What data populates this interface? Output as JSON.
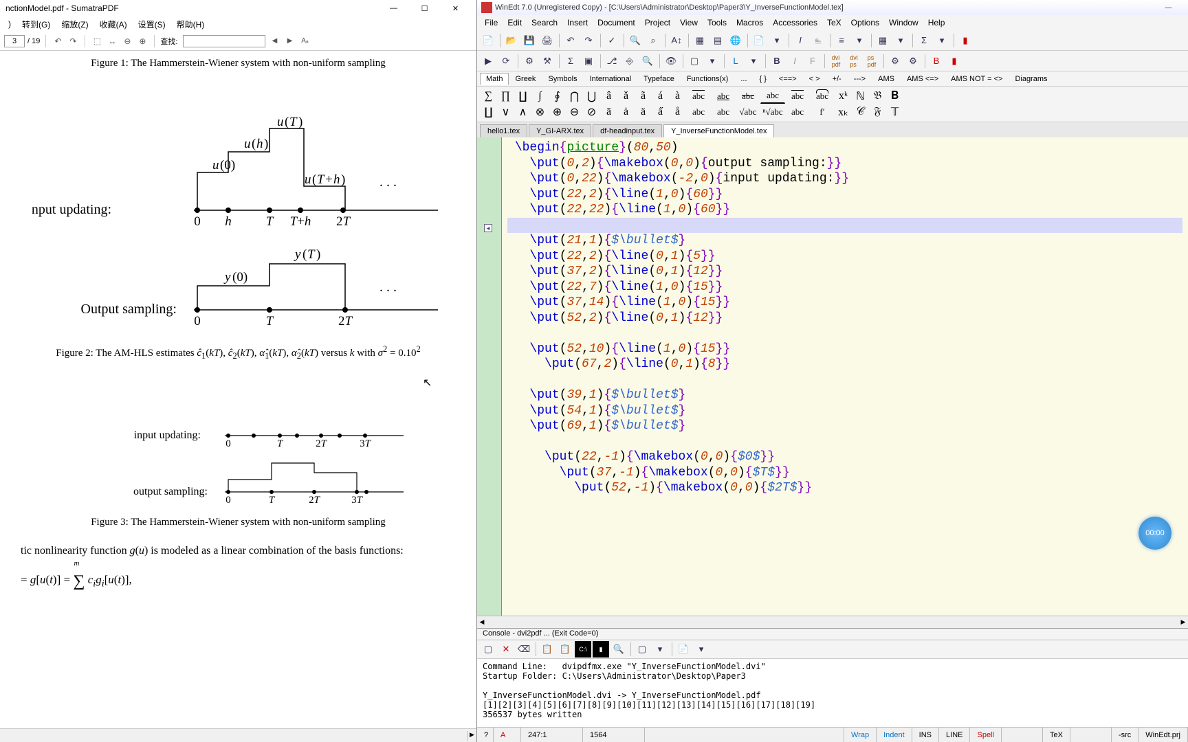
{
  "sumatra": {
    "title": "nctionModel.pdf - SumatraPDF",
    "menu": [
      ")",
      "转到(G)",
      "缩放(Z)",
      "收藏(A)",
      "设置(S)",
      "帮助(H)"
    ],
    "page_current": "3",
    "page_total": "/ 19",
    "search_label": "查找:",
    "search_value": "",
    "captions": {
      "fig1": "Figure 1: The Hammerstein-Wiener system with non-uniform sampling",
      "fig2_pre": "Figure 2: The AM-HLS estimates ",
      "fig2_mid": " versus ",
      "fig2_post": " with ",
      "fig3": "Figure 3: The Hammerstein-Wiener system with non-uniform sampling",
      "body_pre": "tic nonlinearity function ",
      "body_post": " is modeled as a linear combination of the basis functions:"
    },
    "labels": {
      "input_updating": "Input updating:",
      "output_sampling": "Output sampling:",
      "input_updating_s": "input updating:",
      "output_sampling_s": "output sampling:"
    }
  },
  "winedt": {
    "title": "WinEdt 7.0 (Unregistered   Copy)  -  [C:\\Users\\Administrator\\Desktop\\Paper3\\Y_InverseFunctionModel.tex]",
    "menu": [
      "File",
      "Edit",
      "Search",
      "Insert",
      "Document",
      "Project",
      "View",
      "Tools",
      "Macros",
      "Accessories",
      "TeX",
      "Options",
      "Window",
      "Help"
    ],
    "math_tabs": [
      "Math",
      "Greek",
      "Symbols",
      "International",
      "Typeface",
      "Functions(x)",
      "...",
      "{ }",
      "<==>",
      "< >",
      "+/-",
      "--->",
      "AMS",
      "AMS   <=>",
      "AMS NOT = <>",
      "Diagrams"
    ],
    "math_row1": [
      "∑",
      "∏",
      "∐",
      "∫",
      "∮",
      "⋂",
      "⋃",
      "â",
      "ǎ",
      "ã",
      "á",
      "à",
      "abc",
      "abc",
      "abc",
      "abc",
      "abc",
      "abc",
      "xᵏ",
      "ℕ",
      "𝔅",
      "𝐁"
    ],
    "math_row2": [
      "∐",
      "∨",
      "∧",
      "⊗",
      "⊕",
      "⊖",
      "⊘",
      "ā",
      "ȧ",
      "ä",
      "a̋",
      "å",
      "abc",
      "abc",
      "√abc",
      "ⁿ√abc",
      "abc",
      "f′",
      "xₖ",
      "𝒞",
      "𝔉",
      "𝕋"
    ],
    "file_tabs": [
      "hello1.tex",
      "Y_GI-ARX.tex",
      "df-headinput.tex",
      "Y_InverseFunctionModel.tex"
    ],
    "active_tab": 3,
    "code_lines": [
      {
        "indent": 0,
        "raw": "\\begin{picture}(80,50)",
        "type": "begin"
      },
      {
        "indent": 1,
        "raw": "\\put(0,2){\\makebox(0,0){output sampling:}}"
      },
      {
        "indent": 1,
        "raw": "\\put(0,22){\\makebox(-2,0){input updating:}}"
      },
      {
        "indent": 1,
        "raw": "\\put(22,2){\\line(1,0){60}}"
      },
      {
        "indent": 1,
        "raw": "\\put(22,22){\\line(1,0){60}}"
      },
      {
        "indent": 0,
        "raw": "",
        "hl": true
      },
      {
        "indent": 1,
        "raw": "\\put(21,1){$\\bullet$}"
      },
      {
        "indent": 1,
        "raw": "\\put(22,2){\\line(0,1){5}}"
      },
      {
        "indent": 1,
        "raw": "\\put(37,2){\\line(0,1){12}}"
      },
      {
        "indent": 1,
        "raw": "\\put(22,7){\\line(1,0){15}}"
      },
      {
        "indent": 1,
        "raw": "\\put(37,14){\\line(1,0){15}}"
      },
      {
        "indent": 1,
        "raw": "\\put(52,2){\\line(0,1){12}}"
      },
      {
        "indent": 0,
        "raw": ""
      },
      {
        "indent": 1,
        "raw": "\\put(52,10){\\line(1,0){15}}"
      },
      {
        "indent": 2,
        "raw": "\\put(67,2){\\line(0,1){8}}"
      },
      {
        "indent": 0,
        "raw": ""
      },
      {
        "indent": 1,
        "raw": "\\put(39,1){$\\bullet$}"
      },
      {
        "indent": 1,
        "raw": "\\put(54,1){$\\bullet$}"
      },
      {
        "indent": 1,
        "raw": "\\put(69,1){$\\bullet$}"
      },
      {
        "indent": 0,
        "raw": ""
      },
      {
        "indent": 2,
        "raw": "\\put(22,-1){\\makebox(0,0){$0$}}"
      },
      {
        "indent": 3,
        "raw": "\\put(37,-1){\\makebox(0,0){$T$}}"
      },
      {
        "indent": 4,
        "raw": "\\put(52,-1){\\makebox(0,0){$2T$}}"
      }
    ],
    "console": {
      "title": "Console - dvi2pdf ...  (Exit Code=0)",
      "lines": [
        "Command Line:   dvipdfmx.exe \"Y_InverseFunctionModel.dvi\"",
        "Startup Folder: C:\\Users\\Administrator\\Desktop\\Paper3",
        "",
        "Y_InverseFunctionModel.dvi -> Y_InverseFunctionModel.pdf",
        "[1][2][3][4][5][6][7][8][9][10][11][12][13][14][15][16][17][18][19]",
        "356537 bytes written"
      ]
    },
    "status": {
      "mode": "A",
      "pos": "247:1",
      "count": "1564",
      "wrap": "Wrap",
      "indent": "Indent",
      "ins": "INS",
      "line": "LINE",
      "spell": "Spell",
      "tex": "TeX",
      "src": "-src",
      "prj": "WinEdt.prj"
    },
    "badge": "00:00"
  }
}
